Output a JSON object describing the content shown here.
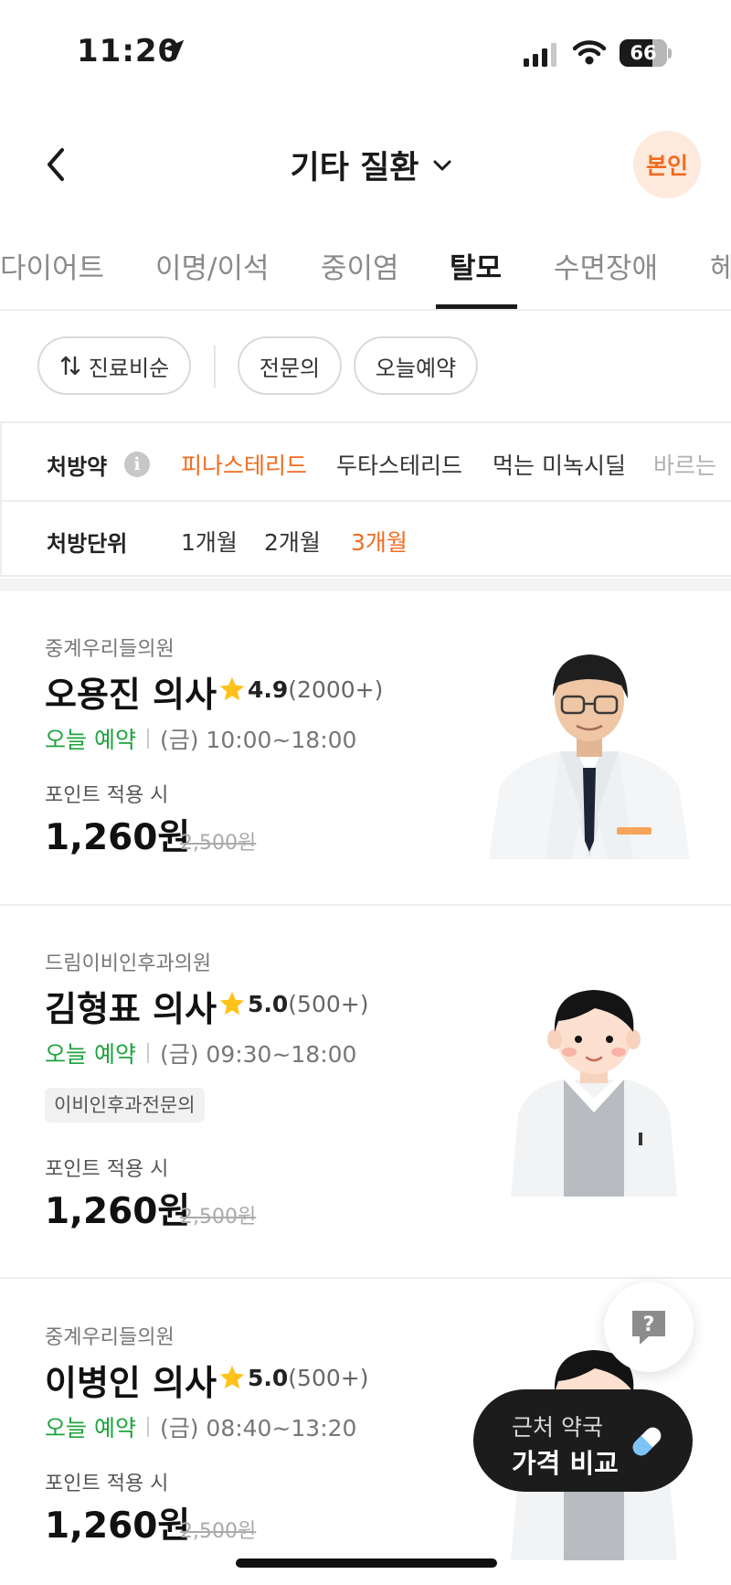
{
  "status_bar": {
    "time": "11:20",
    "battery": "66"
  },
  "header": {
    "title": "기타 질환",
    "profile_badge": "본인"
  },
  "category_tabs": [
    "다이어트",
    "이명/이석",
    "중이염",
    "탈모",
    "수면장애",
    "헤"
  ],
  "active_category": "탈모",
  "filters": {
    "sort_label": "진료비순",
    "chips": [
      "전문의",
      "오늘예약"
    ]
  },
  "prescription": {
    "drug_label": "처방약",
    "drugs": [
      "피나스테리드",
      "두타스테리드",
      "먹는 미녹시딜",
      "바르는"
    ],
    "active_drug": "피나스테리드",
    "unit_label": "처방단위",
    "units": [
      "1개월",
      "2개월",
      "3개월"
    ],
    "active_unit": "3개월"
  },
  "doctors": [
    {
      "clinic": "중계우리들의원",
      "name": "오용진 의사",
      "rating": "4.9",
      "review_count": "(2000+)",
      "status": "오늘 예약",
      "hours": "(금) 10:00~18:00",
      "tag": "",
      "point_label": "포인트 적용 시",
      "price": "1,260원",
      "original_price": "2,500원"
    },
    {
      "clinic": "드림이비인후과의원",
      "name": "김형표 의사",
      "rating": "5.0",
      "review_count": "(500+)",
      "status": "오늘 예약",
      "hours": "(금) 09:30~18:00",
      "tag": "이비인후과전문의",
      "point_label": "포인트 적용 시",
      "price": "1,260원",
      "original_price": "2,500원"
    },
    {
      "clinic": "중계우리들의원",
      "name": "이병인 의사",
      "rating": "5.0",
      "review_count": "(500+)",
      "status": "오늘 예약",
      "hours": "(금) 08:40~13:20",
      "tag": "",
      "point_label": "포인트 적용 시",
      "price": "1,260원",
      "original_price": "2,500원"
    }
  ],
  "pharmacy_button": {
    "line1": "근처 약국",
    "line2": "가격 비교"
  },
  "colors": {
    "accent": "#f26b1f",
    "open_green": "#1fa33e",
    "text": "#1a1a1a",
    "muted": "#8a8a8a"
  },
  "icons": [
    "location-arrow-icon",
    "signal-icon",
    "wifi-icon",
    "back-icon",
    "chevron-down-icon",
    "sort-icon",
    "info-icon",
    "star-icon",
    "help-icon",
    "pill-icon"
  ]
}
